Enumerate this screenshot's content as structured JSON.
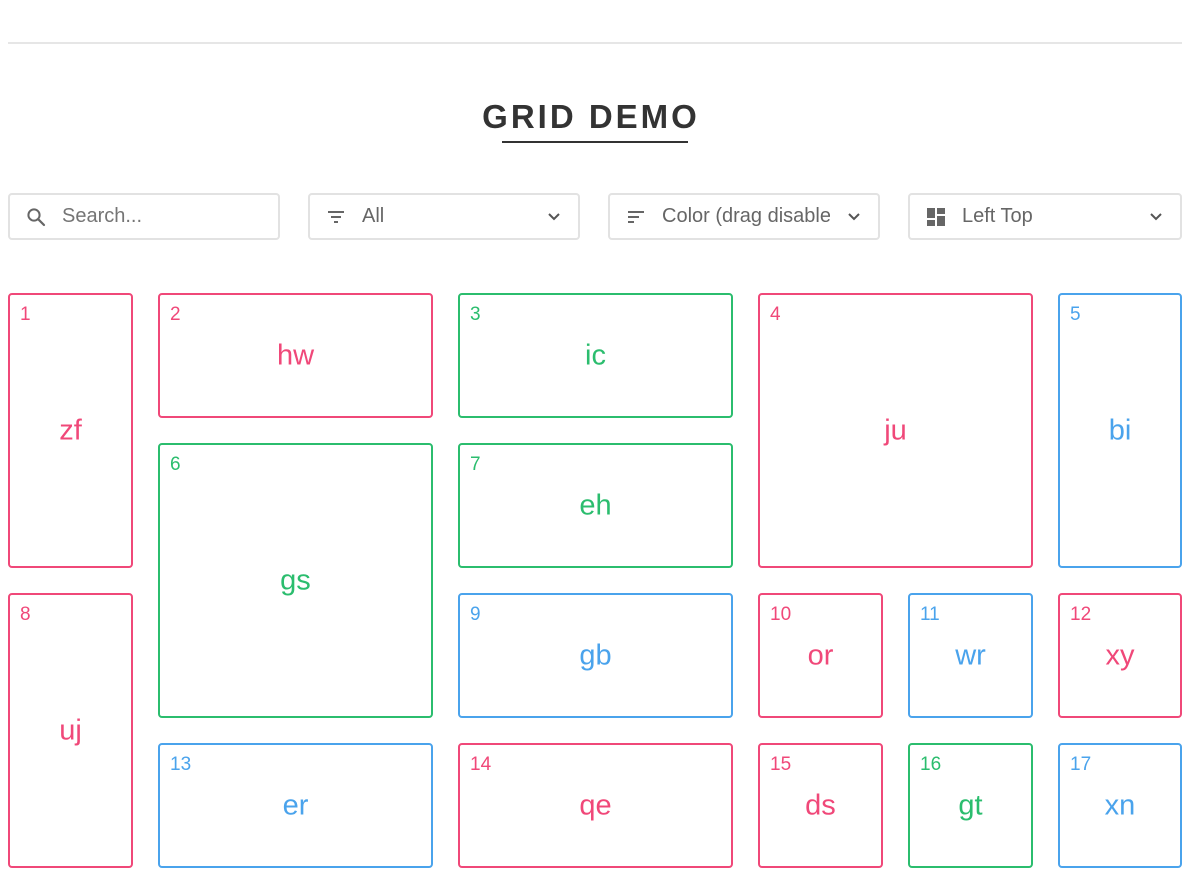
{
  "header": {
    "title": "GRID DEMO"
  },
  "controls": {
    "search": {
      "placeholder": "Search...",
      "icon": "search-icon"
    },
    "filter": {
      "value": "All",
      "icon": "filter-icon"
    },
    "sort": {
      "value": "Color (drag disabled)",
      "icon": "sort-icon"
    },
    "layout": {
      "value": "Left Top",
      "icon": "layout-icon"
    }
  },
  "colors": {
    "red": "#f04879",
    "green": "#2bbd6e",
    "blue": "#4aa3ec",
    "title": "#333333"
  },
  "items": [
    {
      "num": "1",
      "label": "zf",
      "color": "red"
    },
    {
      "num": "2",
      "label": "hw",
      "color": "red"
    },
    {
      "num": "3",
      "label": "ic",
      "color": "green"
    },
    {
      "num": "4",
      "label": "ju",
      "color": "red"
    },
    {
      "num": "5",
      "label": "bi",
      "color": "blue"
    },
    {
      "num": "6",
      "label": "gs",
      "color": "green"
    },
    {
      "num": "7",
      "label": "eh",
      "color": "green"
    },
    {
      "num": "8",
      "label": "uj",
      "color": "red"
    },
    {
      "num": "9",
      "label": "gb",
      "color": "blue"
    },
    {
      "num": "10",
      "label": "or",
      "color": "red"
    },
    {
      "num": "11",
      "label": "wr",
      "color": "blue"
    },
    {
      "num": "12",
      "label": "xy",
      "color": "red"
    },
    {
      "num": "13",
      "label": "er",
      "color": "blue"
    },
    {
      "num": "14",
      "label": "qe",
      "color": "red"
    },
    {
      "num": "15",
      "label": "ds",
      "color": "red"
    },
    {
      "num": "16",
      "label": "gt",
      "color": "green"
    },
    {
      "num": "17",
      "label": "xn",
      "color": "blue"
    }
  ]
}
